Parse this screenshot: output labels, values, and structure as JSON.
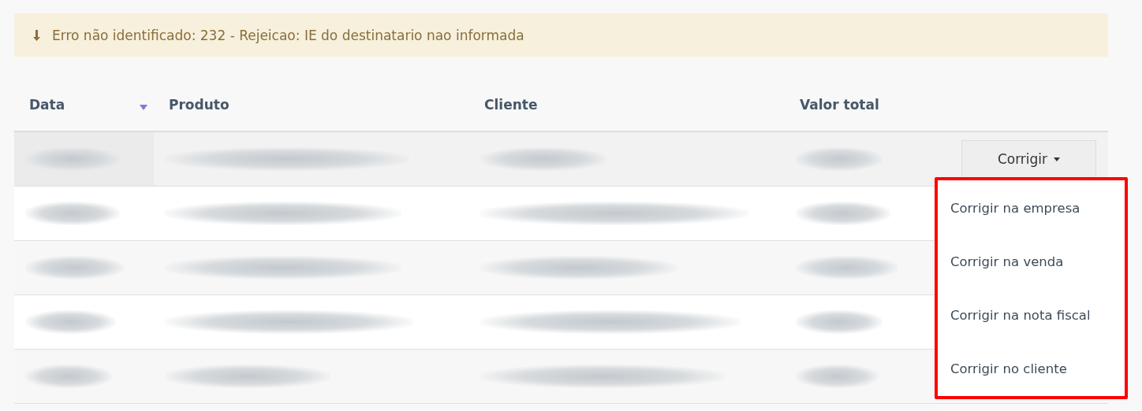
{
  "alert": {
    "text": "Erro não identificado: 232 - Rejeicao: IE do destinatario nao informada"
  },
  "table": {
    "columns": [
      {
        "label": "Data",
        "sorted": true
      },
      {
        "label": "Produto",
        "sorted": false
      },
      {
        "label": "Cliente",
        "sorted": false
      },
      {
        "label": "Valor total",
        "sorted": false
      }
    ],
    "rows": [
      {
        "kind": "redacted",
        "highlighted": true,
        "action": {
          "label": "Corrigir",
          "expanded": true
        }
      },
      {
        "kind": "redacted",
        "highlighted": false
      },
      {
        "kind": "redacted",
        "highlighted": false
      },
      {
        "kind": "redacted",
        "highlighted": false
      },
      {
        "kind": "redacted",
        "highlighted": false
      }
    ]
  },
  "menu": {
    "items": [
      "Corrigir na empresa",
      "Corrigir na venda",
      "Corrigir na nota fiscal",
      "Corrigir no cliente"
    ]
  }
}
